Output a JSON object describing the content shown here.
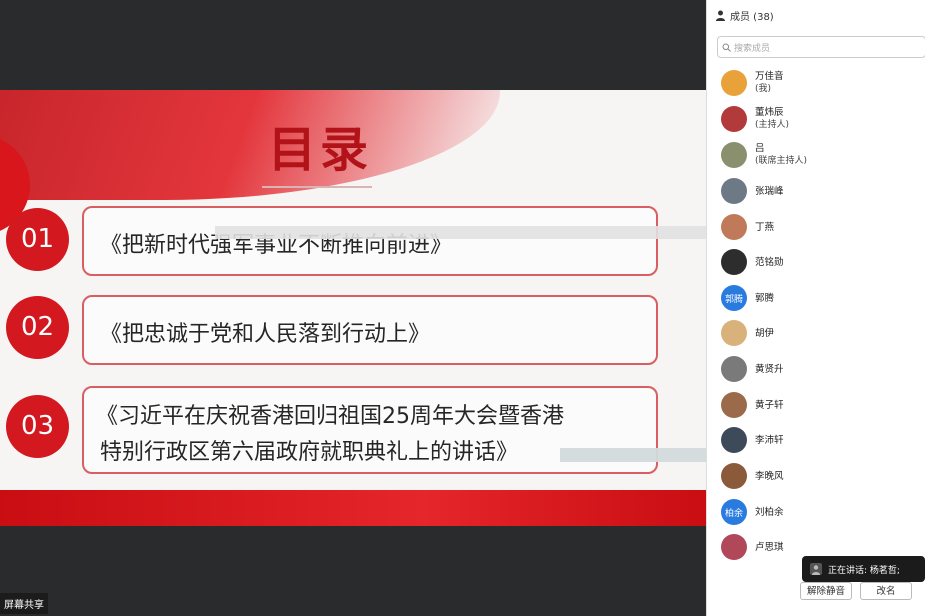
{
  "slide": {
    "title": "目录",
    "items": [
      {
        "number": "01",
        "line1": "《把新时代强军事业不断推向前进》",
        "line2": ""
      },
      {
        "number": "02",
        "line1": "《把忠诚于党和人民落到行动上》",
        "line2": ""
      },
      {
        "number": "03",
        "line1": "《习近平在庆祝香港回归祖国25周年大会暨香港",
        "line2": "特别行政区第六届政府就职典礼上的讲话》"
      }
    ]
  },
  "share_label": "屏幕共享",
  "members_panel": {
    "header": "成员 (38)",
    "search_placeholder": "搜索成员",
    "members": [
      {
        "name": "万佳音",
        "role": "(我)",
        "avatar_text": "",
        "avatar_color": "#e9a13a"
      },
      {
        "name": "董炜辰",
        "role": "(主持人)",
        "avatar_text": "",
        "avatar_color": "#b23a3a"
      },
      {
        "name": "吕",
        "role": "(联席主持人)",
        "avatar_text": "",
        "avatar_color": "#8a8f6e"
      },
      {
        "name": "张瑞峰",
        "role": "",
        "avatar_text": "",
        "avatar_color": "#6d7a86"
      },
      {
        "name": "丁燕",
        "role": "",
        "avatar_text": "",
        "avatar_color": "#c07a5a"
      },
      {
        "name": "范铭勋",
        "role": "",
        "avatar_text": "",
        "avatar_color": "#2d2d2d"
      },
      {
        "name": "郭腾",
        "role": "",
        "avatar_text": "郭腾",
        "avatar_color": "#2a7be0"
      },
      {
        "name": "胡伊",
        "role": "",
        "avatar_text": "",
        "avatar_color": "#d8b27a"
      },
      {
        "name": "黄贤升",
        "role": "",
        "avatar_text": "",
        "avatar_color": "#7a7a7a"
      },
      {
        "name": "黄子轩",
        "role": "",
        "avatar_text": "",
        "avatar_color": "#9a6a4a"
      },
      {
        "name": "李沛轩",
        "role": "",
        "avatar_text": "",
        "avatar_color": "#3d4a5a"
      },
      {
        "name": "李晚风",
        "role": "",
        "avatar_text": "",
        "avatar_color": "#8a5a3a"
      },
      {
        "name": "刘柏余",
        "role": "",
        "avatar_text": "柏余",
        "avatar_color": "#2a7be0"
      },
      {
        "name": "卢思琪",
        "role": "",
        "avatar_text": "",
        "avatar_color": "#b0485a"
      }
    ],
    "speaking_text": "正在讲话: 杨茗哲;",
    "unmute_label": "解除静音",
    "rename_label": "改名"
  },
  "colors": {
    "accent_red": "#d3191f",
    "dark_bg": "#2a2b2d",
    "blue_avatar": "#2a7be0"
  }
}
